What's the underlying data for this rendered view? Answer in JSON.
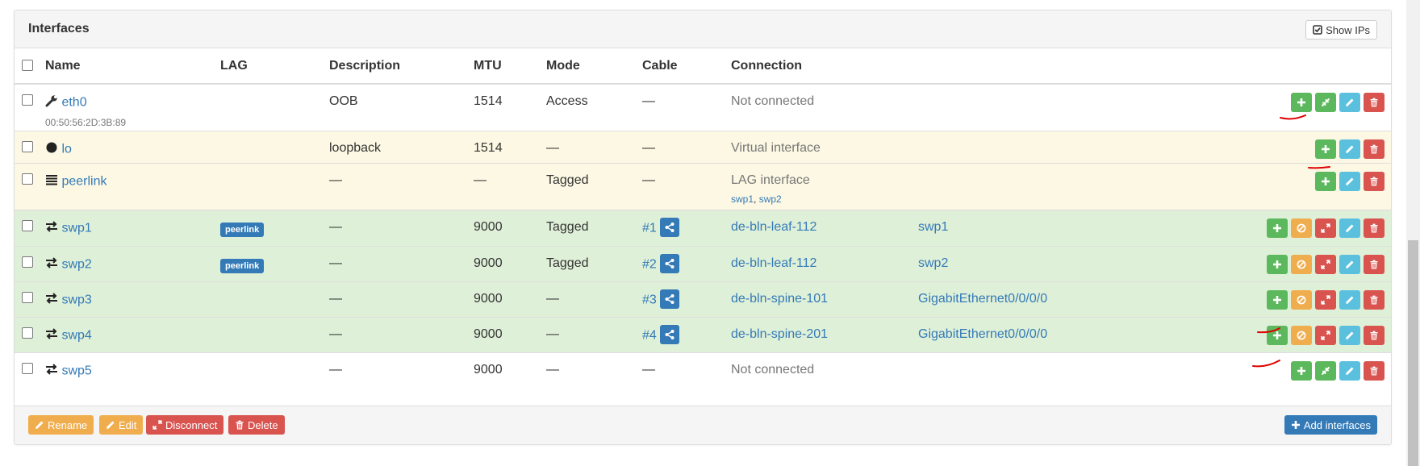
{
  "panel": {
    "title": "Interfaces",
    "show_ips_label": "Show IPs"
  },
  "table": {
    "headers": {
      "name": "Name",
      "lag": "LAG",
      "description": "Description",
      "mtu": "MTU",
      "mode": "Mode",
      "cable": "Cable",
      "connection": "Connection"
    },
    "rows": [
      {
        "name": "eth0",
        "mac": "00:50:56:2D:3B:89",
        "lag": "",
        "description": "OOB",
        "mtu": "1514",
        "mode": "Access",
        "cable": "—",
        "connection": "Not connected",
        "peer_port": ""
      },
      {
        "name": "lo",
        "lag": "",
        "description": "loopback",
        "mtu": "1514",
        "mode": "—",
        "cable": "—",
        "connection": "Virtual interface",
        "peer_port": ""
      },
      {
        "name": "peerlink",
        "lag": "",
        "description": "—",
        "mtu": "—",
        "mode": "Tagged",
        "cable": "—",
        "connection": "LAG interface",
        "members": [
          "swp1",
          "swp2"
        ],
        "members_sep": ", ",
        "peer_port": ""
      },
      {
        "name": "swp1",
        "lag": "peerlink",
        "description": "—",
        "mtu": "9000",
        "mode": "Tagged",
        "cable": "#1",
        "connection": "de-bln-leaf-112",
        "peer_port": "swp1"
      },
      {
        "name": "swp2",
        "lag": "peerlink",
        "description": "—",
        "mtu": "9000",
        "mode": "Tagged",
        "cable": "#2",
        "connection": "de-bln-leaf-112",
        "peer_port": "swp2"
      },
      {
        "name": "swp3",
        "lag": "",
        "description": "—",
        "mtu": "9000",
        "mode": "—",
        "cable": "#3",
        "connection": "de-bln-spine-101",
        "peer_port": "GigabitEthernet0/0/0/0"
      },
      {
        "name": "swp4",
        "lag": "",
        "description": "—",
        "mtu": "9000",
        "mode": "—",
        "cable": "#4",
        "connection": "de-bln-spine-201",
        "peer_port": "GigabitEthernet0/0/0/0"
      },
      {
        "name": "swp5",
        "lag": "",
        "description": "—",
        "mtu": "9000",
        "mode": "—",
        "cable": "—",
        "connection": "Not connected",
        "peer_port": ""
      }
    ]
  },
  "footer": {
    "rename_label": "Rename",
    "edit_label": "Edit",
    "disconnect_label": "Disconnect",
    "delete_label": "Delete",
    "add_interfaces_label": "Add interfaces"
  },
  "icons": {
    "wrench": "wrench-icon",
    "circle": "circle-icon",
    "lines": "bars-icon",
    "arrows": "exchange-icon",
    "share": "share-icon"
  },
  "colors": {
    "link": "#337ab7",
    "success": "#5cb85c",
    "danger": "#d9534f",
    "info": "#5bc0de",
    "warning": "#f0ad4e",
    "annotation": "#e00000"
  }
}
